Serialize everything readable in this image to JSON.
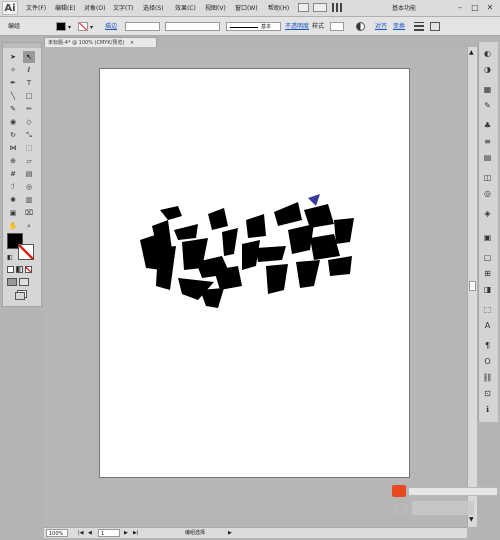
{
  "app": {
    "logo": "Ai",
    "workspace": "基本功能"
  },
  "menu": [
    "文件(F)",
    "编辑(E)",
    "对象(O)",
    "文字(T)",
    "选择(S)",
    "效果(C)",
    "视图(V)",
    "窗口(W)",
    "帮助(H)"
  ],
  "window_controls": {
    "minimize": "–",
    "maximize": "□",
    "close": "✕"
  },
  "control_bar": {
    "selection_label": "编组",
    "stroke_label": "描边",
    "brush_label": "基本",
    "opacity_label": "不透明度",
    "style_label": "样式",
    "align_link": "对齐",
    "transform_link": "变换"
  },
  "document": {
    "tab_title": "未标题-4* @ 100% (CMYK/预览)",
    "close": "×"
  },
  "status": {
    "zoom": "100%",
    "page": "1",
    "tool": "编组选择"
  },
  "icons": [
    "selection-icon",
    "direct-selection-icon",
    "magic-wand-icon",
    "lasso-icon",
    "pen-icon",
    "type-icon",
    "line-icon",
    "rectangle-icon",
    "paintbrush-icon",
    "pencil-icon",
    "blob-brush-icon",
    "eraser-icon",
    "rotate-icon",
    "scale-icon",
    "width-icon",
    "free-transform-icon",
    "shape-builder-icon",
    "perspective-icon",
    "mesh-icon",
    "gradient-icon",
    "eyedropper-icon",
    "blend-icon",
    "symbol-sprayer-icon",
    "graph-icon",
    "artboard-icon",
    "slice-icon",
    "hand-icon",
    "zoom-icon"
  ],
  "colors": {
    "fill": "#000000",
    "stroke": "#ffffff",
    "accent_blue": "#3a3a9a"
  }
}
